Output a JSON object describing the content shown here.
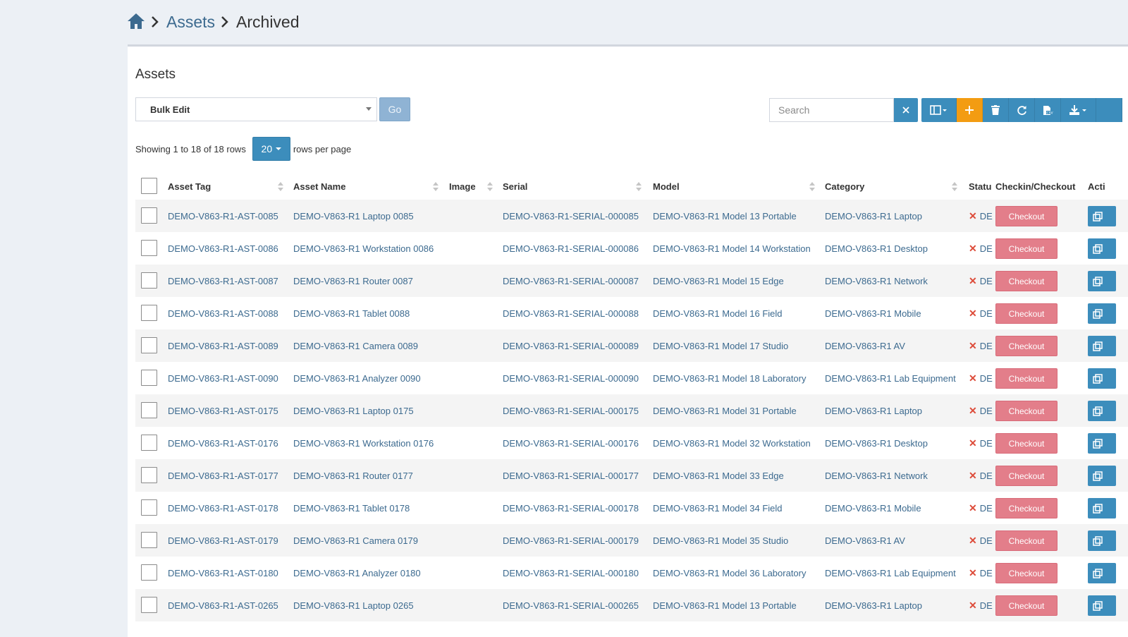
{
  "breadcrumb": {
    "items": [
      {
        "label": "Assets",
        "link": true
      },
      {
        "label": "Archived",
        "link": false
      }
    ]
  },
  "box": {
    "title": "Assets"
  },
  "bulk": {
    "selected": "Bulk Edit",
    "go_label": "Go"
  },
  "search": {
    "placeholder": "Search",
    "value": ""
  },
  "pagination": {
    "showing": "Showing 1 to 18 of 18 rows",
    "page_size": "20",
    "suffix": "rows per page"
  },
  "table": {
    "columns": [
      {
        "key": "asset_tag",
        "label": "Asset Tag"
      },
      {
        "key": "asset_name",
        "label": "Asset Name"
      },
      {
        "key": "image",
        "label": "Image"
      },
      {
        "key": "serial",
        "label": "Serial"
      },
      {
        "key": "model",
        "label": "Model"
      },
      {
        "key": "category",
        "label": "Category"
      },
      {
        "key": "status",
        "label": "Statu"
      },
      {
        "key": "checkin",
        "label": "Checkin/Checkout"
      },
      {
        "key": "actions",
        "label": "Acti"
      }
    ],
    "checkout_label": "Checkout",
    "rows": [
      {
        "tag": "DEMO-V863-R1-AST-0085",
        "name": "DEMO-V863-R1 Laptop 0085",
        "serial": "DEMO-V863-R1-SERIAL-000085",
        "model": "DEMO-V863-R1 Model 13 Portable",
        "category": "DEMO-V863-R1 Laptop",
        "status": "DE"
      },
      {
        "tag": "DEMO-V863-R1-AST-0086",
        "name": "DEMO-V863-R1 Workstation 0086",
        "serial": "DEMO-V863-R1-SERIAL-000086",
        "model": "DEMO-V863-R1 Model 14 Workstation",
        "category": "DEMO-V863-R1 Desktop",
        "status": "DE"
      },
      {
        "tag": "DEMO-V863-R1-AST-0087",
        "name": "DEMO-V863-R1 Router 0087",
        "serial": "DEMO-V863-R1-SERIAL-000087",
        "model": "DEMO-V863-R1 Model 15 Edge",
        "category": "DEMO-V863-R1 Network",
        "status": "DE"
      },
      {
        "tag": "DEMO-V863-R1-AST-0088",
        "name": "DEMO-V863-R1 Tablet 0088",
        "serial": "DEMO-V863-R1-SERIAL-000088",
        "model": "DEMO-V863-R1 Model 16 Field",
        "category": "DEMO-V863-R1 Mobile",
        "status": "DE"
      },
      {
        "tag": "DEMO-V863-R1-AST-0089",
        "name": "DEMO-V863-R1 Camera 0089",
        "serial": "DEMO-V863-R1-SERIAL-000089",
        "model": "DEMO-V863-R1 Model 17 Studio",
        "category": "DEMO-V863-R1 AV",
        "status": "DE"
      },
      {
        "tag": "DEMO-V863-R1-AST-0090",
        "name": "DEMO-V863-R1 Analyzer 0090",
        "serial": "DEMO-V863-R1-SERIAL-000090",
        "model": "DEMO-V863-R1 Model 18 Laboratory",
        "category": "DEMO-V863-R1 Lab Equipment",
        "status": "DE"
      },
      {
        "tag": "DEMO-V863-R1-AST-0175",
        "name": "DEMO-V863-R1 Laptop 0175",
        "serial": "DEMO-V863-R1-SERIAL-000175",
        "model": "DEMO-V863-R1 Model 31 Portable",
        "category": "DEMO-V863-R1 Laptop",
        "status": "DE"
      },
      {
        "tag": "DEMO-V863-R1-AST-0176",
        "name": "DEMO-V863-R1 Workstation 0176",
        "serial": "DEMO-V863-R1-SERIAL-000176",
        "model": "DEMO-V863-R1 Model 32 Workstation",
        "category": "DEMO-V863-R1 Desktop",
        "status": "DE"
      },
      {
        "tag": "DEMO-V863-R1-AST-0177",
        "name": "DEMO-V863-R1 Router 0177",
        "serial": "DEMO-V863-R1-SERIAL-000177",
        "model": "DEMO-V863-R1 Model 33 Edge",
        "category": "DEMO-V863-R1 Network",
        "status": "DE"
      },
      {
        "tag": "DEMO-V863-R1-AST-0178",
        "name": "DEMO-V863-R1 Tablet 0178",
        "serial": "DEMO-V863-R1-SERIAL-000178",
        "model": "DEMO-V863-R1 Model 34 Field",
        "category": "DEMO-V863-R1 Mobile",
        "status": "DE"
      },
      {
        "tag": "DEMO-V863-R1-AST-0179",
        "name": "DEMO-V863-R1 Camera 0179",
        "serial": "DEMO-V863-R1-SERIAL-000179",
        "model": "DEMO-V863-R1 Model 35 Studio",
        "category": "DEMO-V863-R1 AV",
        "status": "DE"
      },
      {
        "tag": "DEMO-V863-R1-AST-0180",
        "name": "DEMO-V863-R1 Analyzer 0180",
        "serial": "DEMO-V863-R1-SERIAL-000180",
        "model": "DEMO-V863-R1 Model 36 Laboratory",
        "category": "DEMO-V863-R1 Lab Equipment",
        "status": "DE"
      },
      {
        "tag": "DEMO-V863-R1-AST-0265",
        "name": "DEMO-V863-R1 Laptop 0265",
        "serial": "DEMO-V863-R1-SERIAL-000265",
        "model": "DEMO-V863-R1 Model 13 Portable",
        "category": "DEMO-V863-R1 Laptop",
        "status": "DE"
      }
    ]
  },
  "toolbar": {
    "icons": [
      "columns-icon",
      "plus-icon",
      "trash-icon",
      "refresh-icon",
      "csv-export-icon",
      "download-icon"
    ]
  },
  "colors": {
    "primary": "#3c8dbc",
    "warning": "#f39c12",
    "danger_x": "#dd4b39",
    "checkout": "#e37e8a",
    "link": "#3c6a8f",
    "background": "#ecf0f5"
  }
}
